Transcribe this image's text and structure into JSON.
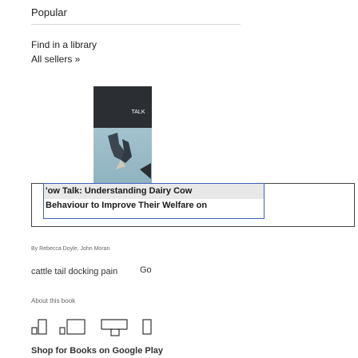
{
  "popular": {
    "title": "Popular",
    "find_in_library": "Find in a library",
    "all_sellers": "All sellers »"
  },
  "book": {
    "cover_label": "TALK",
    "title_line1": "'ow Talk: Understanding Dairy Cow",
    "title_line2": "Behaviour to Improve Their Welfare on",
    "authors": "By Rebecca Doyle, John Moran"
  },
  "search": {
    "query": "cattle tail docking pain",
    "go_label": "Go"
  },
  "about": {
    "label": "About this book"
  },
  "shop": {
    "label": "Shop for Books on Google Play"
  },
  "colors": {
    "cover_top": "#2b2f33",
    "cover_gradient_start": "#b2cfd7",
    "cover_gradient_end": "#8fb3c0",
    "selection_border": "#4060c0"
  }
}
